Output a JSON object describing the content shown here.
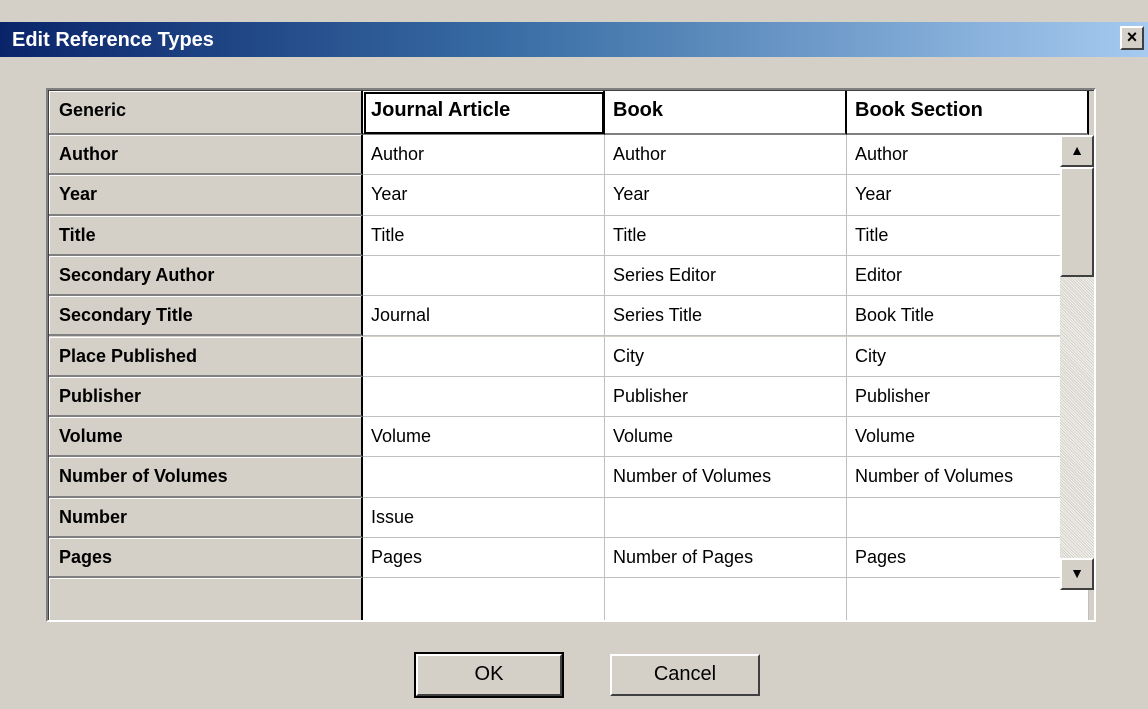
{
  "window": {
    "title": "Edit Reference Types",
    "close_glyph": "×"
  },
  "grid": {
    "corner_header": "Generic",
    "columns": [
      "Journal Article",
      "Book",
      "Book Section"
    ],
    "selected_column": "Journal Article",
    "rows": [
      {
        "field": "Author",
        "values": [
          "Author",
          "Author",
          "Author"
        ]
      },
      {
        "field": "Year",
        "values": [
          "Year",
          "Year",
          "Year"
        ]
      },
      {
        "field": "Title",
        "values": [
          "Title",
          "Title",
          "Title"
        ]
      },
      {
        "field": "Secondary Author",
        "values": [
          "",
          "Series Editor",
          "Editor"
        ]
      },
      {
        "field": "Secondary Title",
        "values": [
          "Journal",
          "Series Title",
          "Book Title"
        ]
      },
      {
        "field": "Place Published",
        "values": [
          "",
          "City",
          "City"
        ]
      },
      {
        "field": "Publisher",
        "values": [
          "",
          "Publisher",
          "Publisher"
        ]
      },
      {
        "field": "Volume",
        "values": [
          "Volume",
          "Volume",
          "Volume"
        ]
      },
      {
        "field": "Number of Volumes",
        "values": [
          "",
          "Number of Volumes",
          "Number of Volumes"
        ]
      },
      {
        "field": "Number",
        "values": [
          "Issue",
          "",
          ""
        ]
      },
      {
        "field": "Pages",
        "values": [
          "Pages",
          "Number of Pages",
          "Pages"
        ]
      }
    ]
  },
  "scrollbars": {
    "up_icon": "▲",
    "down_icon": "▼",
    "left_icon": "◀",
    "right_icon": "▶"
  },
  "buttons": {
    "ok": "OK",
    "cancel": "Cancel"
  }
}
